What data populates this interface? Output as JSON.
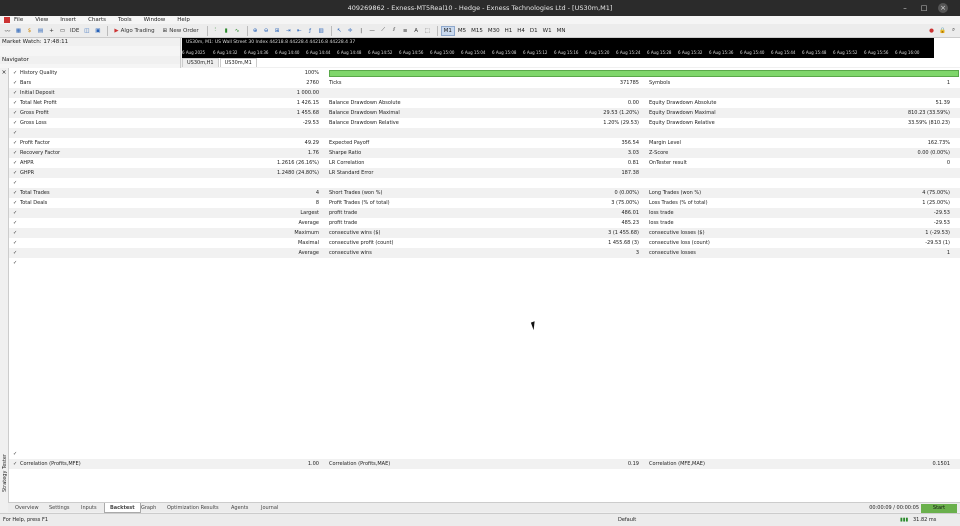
{
  "window": {
    "title": "409269862 - Exness-MT5Real10 - Hedge - Exness Technologies Ltd - [US30m,M1]"
  },
  "menu": [
    "File",
    "View",
    "Insert",
    "Charts",
    "Tools",
    "Window",
    "Help"
  ],
  "toolbar": {
    "algo_trading": "Algo Trading",
    "new_order": "New Order",
    "timeframes": [
      "M1",
      "M5",
      "M15",
      "M30",
      "H1",
      "H4",
      "D1",
      "W1",
      "MN"
    ],
    "active_timeframe": "M1"
  },
  "left_panel": {
    "market_watch": "Market Watch: 17:48:11",
    "navigator": "Navigator"
  },
  "chart": {
    "symbol_line": "US30m, M1:  US Wall Street 30 Index  44218.8 44228.4 44216.8 44228.4  37",
    "time_labels": [
      "6 Aug 2025",
      "6 Aug 14:32",
      "6 Aug 14:36",
      "6 Aug 14:40",
      "6 Aug 14:44",
      "6 Aug 14:48",
      "6 Aug 14:52",
      "6 Aug 14:56",
      "6 Aug 15:00",
      "6 Aug 15:04",
      "6 Aug 15:08",
      "6 Aug 15:12",
      "6 Aug 15:16",
      "6 Aug 15:20",
      "6 Aug 15:24",
      "6 Aug 15:28",
      "6 Aug 15:32",
      "6 Aug 15:36",
      "6 Aug 15:40",
      "6 Aug 15:44",
      "6 Aug 15:48",
      "6 Aug 15:52",
      "6 Aug 15:56",
      "6 Aug 16:00"
    ],
    "tabs": [
      "US30m,H1",
      "US30m,M1"
    ],
    "active_tab": "US30m,M1"
  },
  "report": {
    "history_quality": {
      "label": "History Quality",
      "value": "100%",
      "fill": 1.0
    },
    "rows": [
      {
        "l1": "Bars",
        "v1": "2760",
        "l2": "Ticks",
        "v2": "371785",
        "l3": "Symbols",
        "v3": "1",
        "alt": false
      },
      {
        "l1": "Initial Deposit",
        "v1": "1 000.00",
        "l2": "",
        "v2": "",
        "l3": "",
        "v3": "",
        "alt": true
      },
      {
        "l1": "Total Net Profit",
        "v1": "1 426.15",
        "l2": "Balance Drawdown Absolute",
        "v2": "0.00",
        "l3": "Equity Drawdown Absolute",
        "v3": "51.39",
        "alt": false
      },
      {
        "l1": "Gross Profit",
        "v1": "1 455.68",
        "l2": "Balance Drawdown Maximal",
        "v2": "29.53 (1.20%)",
        "l3": "Equity Drawdown Maximal",
        "v3": "810.23 (33.59%)",
        "alt": true
      },
      {
        "l1": "Gross Loss",
        "v1": "-29.53",
        "l2": "Balance Drawdown Relative",
        "v2": "1.20% (29.53)",
        "l3": "Equity Drawdown Relative",
        "v3": "33.59% (810.23)",
        "alt": false
      },
      {
        "l1": "",
        "v1": "",
        "l2": "",
        "v2": "",
        "l3": "",
        "v3": "",
        "alt": true
      },
      {
        "l1": "Profit Factor",
        "v1": "49.29",
        "l2": "Expected Payoff",
        "v2": "356.54",
        "l3": "Margin Level",
        "v3": "162.73%",
        "alt": false
      },
      {
        "l1": "Recovery Factor",
        "v1": "1.76",
        "l2": "Sharpe Ratio",
        "v2": "3.03",
        "l3": "Z-Score",
        "v3": "0.00 (0.00%)",
        "alt": true
      },
      {
        "l1": "AHPR",
        "v1": "1.2616 (26.16%)",
        "l2": "LR Correlation",
        "v2": "0.81",
        "l3": "OnTester result",
        "v3": "0",
        "alt": false
      },
      {
        "l1": "GHPR",
        "v1": "1.2480 (24.80%)",
        "l2": "LR Standard Error",
        "v2": "187.38",
        "l3": "",
        "v3": "",
        "alt": true
      },
      {
        "l1": "",
        "v1": "",
        "l2": "",
        "v2": "",
        "l3": "",
        "v3": "",
        "alt": false
      },
      {
        "l1": "Total Trades",
        "v1": "4",
        "l2": "Short Trades (won %)",
        "v2": "0 (0.00%)",
        "l3": "Long Trades (won %)",
        "v3": "4 (75.00%)",
        "alt": true
      },
      {
        "l1": "Total Deals",
        "v1": "8",
        "l2": "Profit Trades (% of total)",
        "v2": "3 (75.00%)",
        "l3": "Loss Trades (% of total)",
        "v3": "1 (25.00%)",
        "alt": false
      },
      {
        "l1": "",
        "v1": "Largest",
        "l2": "profit trade",
        "v2": "486.01",
        "l3": "loss trade",
        "v3": "-29.53",
        "alt": true
      },
      {
        "l1": "",
        "v1": "Average",
        "l2": "profit trade",
        "v2": "485.23",
        "l3": "loss trade",
        "v3": "-29.53",
        "alt": false
      },
      {
        "l1": "",
        "v1": "Maximum",
        "l2": "consecutive wins ($)",
        "v2": "3 (1 455.68)",
        "l3": "consecutive losses ($)",
        "v3": "1 (-29.53)",
        "alt": true
      },
      {
        "l1": "",
        "v1": "Maximal",
        "l2": "consecutive profit (count)",
        "v2": "1 455.68 (3)",
        "l3": "consecutive loss (count)",
        "v3": "-29.53 (1)",
        "alt": false
      },
      {
        "l1": "",
        "v1": "Average",
        "l2": "consecutive wins",
        "v2": "3",
        "l3": "consecutive losses",
        "v3": "1",
        "alt": true
      },
      {
        "l1": "",
        "v1": "",
        "l2": "",
        "v2": "",
        "l3": "",
        "v3": "",
        "alt": false
      }
    ],
    "correlation": {
      "l1": "Correlation (Profits,MFE)",
      "v1": "1.00",
      "l2": "Correlation (Profits,MAE)",
      "v2": "0.19",
      "l3": "Correlation (MFE,MAE)",
      "v3": "0.1501"
    }
  },
  "side_label": "Strategy Tester",
  "bottom_tabs": [
    "Overview",
    "Settings",
    "Inputs",
    "Backtest",
    "Graph",
    "Optimization Results",
    "Agents",
    "Journal"
  ],
  "active_bottom_tab": "Backtest",
  "timer": "00:00:09 / 00:00:05",
  "start_label": "Start",
  "status": {
    "help": "For Help, press F1",
    "profile": "Default",
    "ping": "31.82 ms"
  }
}
